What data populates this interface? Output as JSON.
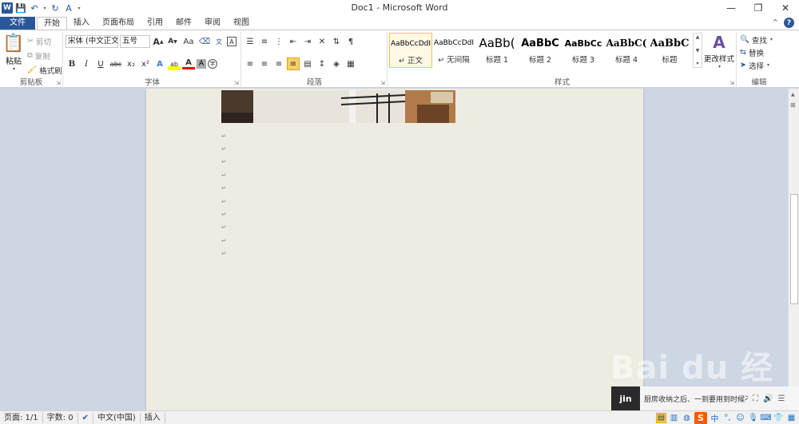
{
  "window": {
    "title": "Doc1 - Microsoft Word"
  },
  "qat": {
    "word_logo": "W",
    "customize": "▾"
  },
  "tabs": [
    {
      "label": "文件"
    },
    {
      "label": "开始"
    },
    {
      "label": "插入"
    },
    {
      "label": "页面布局"
    },
    {
      "label": "引用"
    },
    {
      "label": "邮件"
    },
    {
      "label": "审阅"
    },
    {
      "label": "视图"
    }
  ],
  "ribbon": {
    "clipboard": {
      "label": "剪贴板",
      "paste": "粘贴",
      "cut": "剪切",
      "copy": "复制",
      "format_painter": "格式刷"
    },
    "font": {
      "label": "字体",
      "font_name": "宋体 (中文正文)",
      "font_size": "五号",
      "bold": "B",
      "italic": "I",
      "underline": "U",
      "strike": "abc",
      "sub": "x₂",
      "sup": "x²",
      "grow": "A",
      "shrink": "A",
      "case": "Aa",
      "highlight": "ab",
      "color": "A",
      "char_shade": "A"
    },
    "paragraph": {
      "label": "段落"
    },
    "styles": {
      "label": "样式",
      "change_styles": "更改样式",
      "items": [
        {
          "sample": "AaBbCcDdI",
          "name": "↵ 正文"
        },
        {
          "sample": "AaBbCcDdI",
          "name": "↵ 无间隔"
        },
        {
          "sample": "AaBb(",
          "name": "标题 1"
        },
        {
          "sample": "AaBbC",
          "name": "标题 2"
        },
        {
          "sample": "AaBbCc",
          "name": "标题 3"
        },
        {
          "sample": "AaBbC(",
          "name": "标题 4"
        },
        {
          "sample": "AaBbC",
          "name": "标题"
        }
      ]
    },
    "editing": {
      "label": "编辑",
      "find": "查找",
      "replace": "替换",
      "select": "选择"
    }
  },
  "document": {
    "paragraph_mark": "↵",
    "empty_paragraphs": 10
  },
  "watermark": {
    "text": "Bai du 经验"
  },
  "video": {
    "thumb_text": "jin",
    "title": "厨房收纳之后、一到要用到时候不",
    "volume": "🔊",
    "menu": "☰"
  },
  "status": {
    "page": "页面: 1/1",
    "words": "字数: 0",
    "lang": "中文(中国)",
    "mode": "插入"
  },
  "ime": {
    "logo": "S",
    "lang": "中"
  },
  "colors": {
    "accent": "#2b579a",
    "page": "#eeece1",
    "desk": "#cdd6e3"
  }
}
